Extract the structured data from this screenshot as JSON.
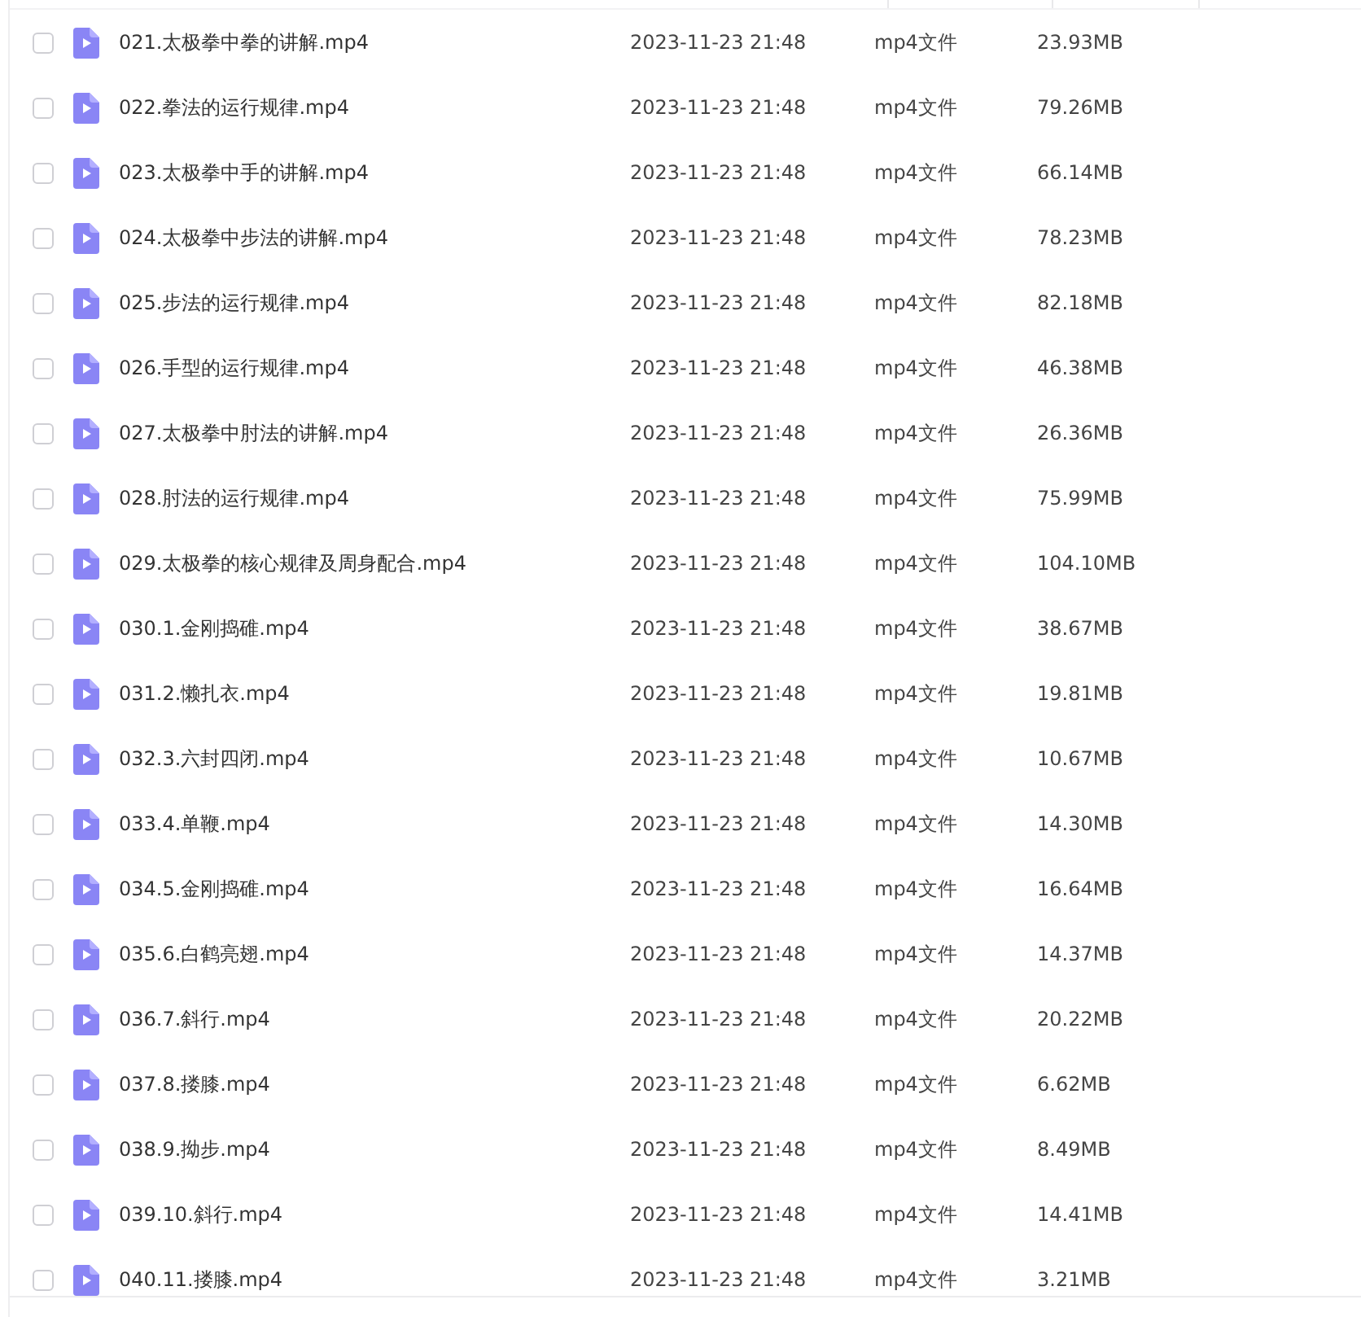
{
  "files": [
    {
      "name": "021.太极拳中拳的讲解.mp4",
      "modified": "2023-11-23 21:48",
      "type": "mp4文件",
      "size": "23.93MB",
      "selected": false
    },
    {
      "name": "022.拳法的运行规律.mp4",
      "modified": "2023-11-23 21:48",
      "type": "mp4文件",
      "size": "79.26MB",
      "selected": false
    },
    {
      "name": "023.太极拳中手的讲解.mp4",
      "modified": "2023-11-23 21:48",
      "type": "mp4文件",
      "size": "66.14MB",
      "selected": false
    },
    {
      "name": "024.太极拳中步法的讲解.mp4",
      "modified": "2023-11-23 21:48",
      "type": "mp4文件",
      "size": "78.23MB",
      "selected": false
    },
    {
      "name": "025.步法的运行规律.mp4",
      "modified": "2023-11-23 21:48",
      "type": "mp4文件",
      "size": "82.18MB",
      "selected": false
    },
    {
      "name": "026.手型的运行规律.mp4",
      "modified": "2023-11-23 21:48",
      "type": "mp4文件",
      "size": "46.38MB",
      "selected": false
    },
    {
      "name": "027.太极拳中肘法的讲解.mp4",
      "modified": "2023-11-23 21:48",
      "type": "mp4文件",
      "size": "26.36MB",
      "selected": false
    },
    {
      "name": "028.肘法的运行规律.mp4",
      "modified": "2023-11-23 21:48",
      "type": "mp4文件",
      "size": "75.99MB",
      "selected": false
    },
    {
      "name": "029.太极拳的核心规律及周身配合.mp4",
      "modified": "2023-11-23 21:48",
      "type": "mp4文件",
      "size": "104.10MB",
      "selected": false
    },
    {
      "name": "030.1.金刚捣碓.mp4",
      "modified": "2023-11-23 21:48",
      "type": "mp4文件",
      "size": "38.67MB",
      "selected": false
    },
    {
      "name": "031.2.懒扎衣.mp4",
      "modified": "2023-11-23 21:48",
      "type": "mp4文件",
      "size": "19.81MB",
      "selected": false
    },
    {
      "name": "032.3.六封四闭.mp4",
      "modified": "2023-11-23 21:48",
      "type": "mp4文件",
      "size": "10.67MB",
      "selected": false
    },
    {
      "name": "033.4.单鞭.mp4",
      "modified": "2023-11-23 21:48",
      "type": "mp4文件",
      "size": "14.30MB",
      "selected": false
    },
    {
      "name": "034.5.金刚捣碓.mp4",
      "modified": "2023-11-23 21:48",
      "type": "mp4文件",
      "size": "16.64MB",
      "selected": false
    },
    {
      "name": "035.6.白鹤亮翅.mp4",
      "modified": "2023-11-23 21:48",
      "type": "mp4文件",
      "size": "14.37MB",
      "selected": false
    },
    {
      "name": "036.7.斜行.mp4",
      "modified": "2023-11-23 21:48",
      "type": "mp4文件",
      "size": "20.22MB",
      "selected": false
    },
    {
      "name": "037.8.搂膝.mp4",
      "modified": "2023-11-23 21:48",
      "type": "mp4文件",
      "size": "6.62MB",
      "selected": false
    },
    {
      "name": "038.9.拗步.mp4",
      "modified": "2023-11-23 21:48",
      "type": "mp4文件",
      "size": "8.49MB",
      "selected": false
    },
    {
      "name": "039.10.斜行.mp4",
      "modified": "2023-11-23 21:48",
      "type": "mp4文件",
      "size": "14.41MB",
      "selected": false
    },
    {
      "name": "040.11.搂膝.mp4",
      "modified": "2023-11-23 21:48",
      "type": "mp4文件",
      "size": "3.21MB",
      "selected": false
    }
  ]
}
